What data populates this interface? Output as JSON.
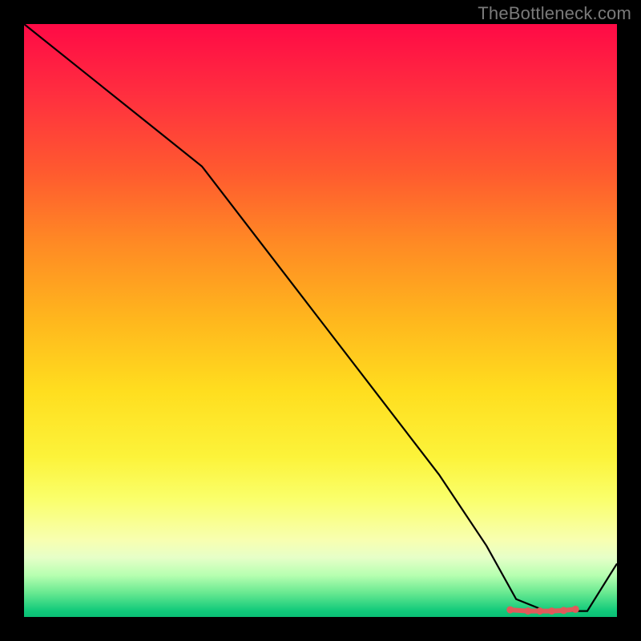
{
  "watermark": "TheBottleneck.com",
  "chart_data": {
    "type": "line",
    "title": "",
    "xlabel": "",
    "ylabel": "",
    "xlim": [
      0,
      100
    ],
    "ylim": [
      0,
      100
    ],
    "background_gradient": {
      "top": "#ff0a46",
      "middle": "#ffde1f",
      "bottom": "#10c97a"
    },
    "series": [
      {
        "name": "curve",
        "color": "#000000",
        "x": [
          0,
          10,
          20,
          30,
          40,
          50,
          60,
          70,
          78,
          83,
          88,
          92,
          95,
          100
        ],
        "y": [
          100,
          92,
          84,
          76,
          63,
          50,
          37,
          24,
          12,
          3,
          1,
          1,
          1,
          9
        ]
      }
    ],
    "markers": {
      "name": "bottom-cluster",
      "color": "#e05a5a",
      "x": [
        82,
        85,
        87,
        89,
        91,
        93
      ],
      "y": [
        1.2,
        1.0,
        1.0,
        1.0,
        1.1,
        1.3
      ]
    }
  }
}
